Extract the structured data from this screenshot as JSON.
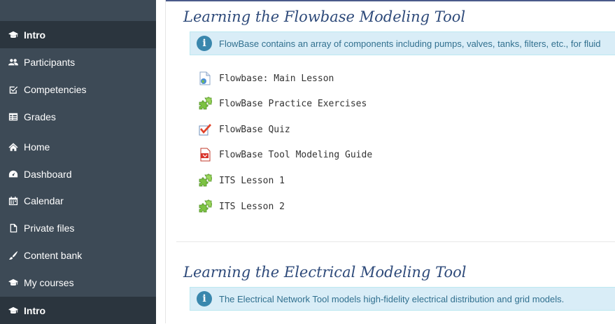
{
  "sidebar": {
    "items": [
      {
        "label": "Intro",
        "icon": "graduation-cap-icon",
        "active": true
      },
      {
        "label": "Participants",
        "icon": "users-icon"
      },
      {
        "label": "Competencies",
        "icon": "check-square-icon"
      },
      {
        "label": "Grades",
        "icon": "table-icon"
      },
      {
        "label": "Home",
        "icon": "home-icon"
      },
      {
        "label": "Dashboard",
        "icon": "dashboard-icon"
      },
      {
        "label": "Calendar",
        "icon": "calendar-icon"
      },
      {
        "label": "Private files",
        "icon": "file-icon"
      },
      {
        "label": "Content bank",
        "icon": "paint-brush-icon"
      },
      {
        "label": "My courses",
        "icon": "graduation-cap-icon"
      },
      {
        "label": "Intro",
        "icon": "graduation-cap-icon",
        "active": true
      }
    ]
  },
  "sections": [
    {
      "title": "Learning the Flowbase Modeling Tool",
      "info": "FlowBase contains an array of components including pumps, valves, tanks, filters, etc., for fluid",
      "activities": [
        {
          "name": "Flowbase: Main Lesson",
          "icon": "page-icon"
        },
        {
          "name": "FlowBase Practice Exercises",
          "icon": "puzzle-icon"
        },
        {
          "name": "FlowBase Quiz",
          "icon": "quiz-checkmark-icon"
        },
        {
          "name": "FlowBase Tool Modeling Guide",
          "icon": "pdf-icon"
        },
        {
          "name": "ITS Lesson 1",
          "icon": "puzzle-icon"
        },
        {
          "name": "ITS Lesson 2",
          "icon": "puzzle-icon"
        }
      ]
    },
    {
      "title": "Learning the Electrical Modeling Tool",
      "info": "The Electrical Network Tool models high-fidelity electrical distribution and grid models."
    }
  ],
  "colors": {
    "sidebar_bg": "#3d4a56",
    "sidebar_active": "#2b353e",
    "section_title": "#2e4a7a",
    "info_bg": "#d9edf7",
    "info_text": "#31708f"
  }
}
